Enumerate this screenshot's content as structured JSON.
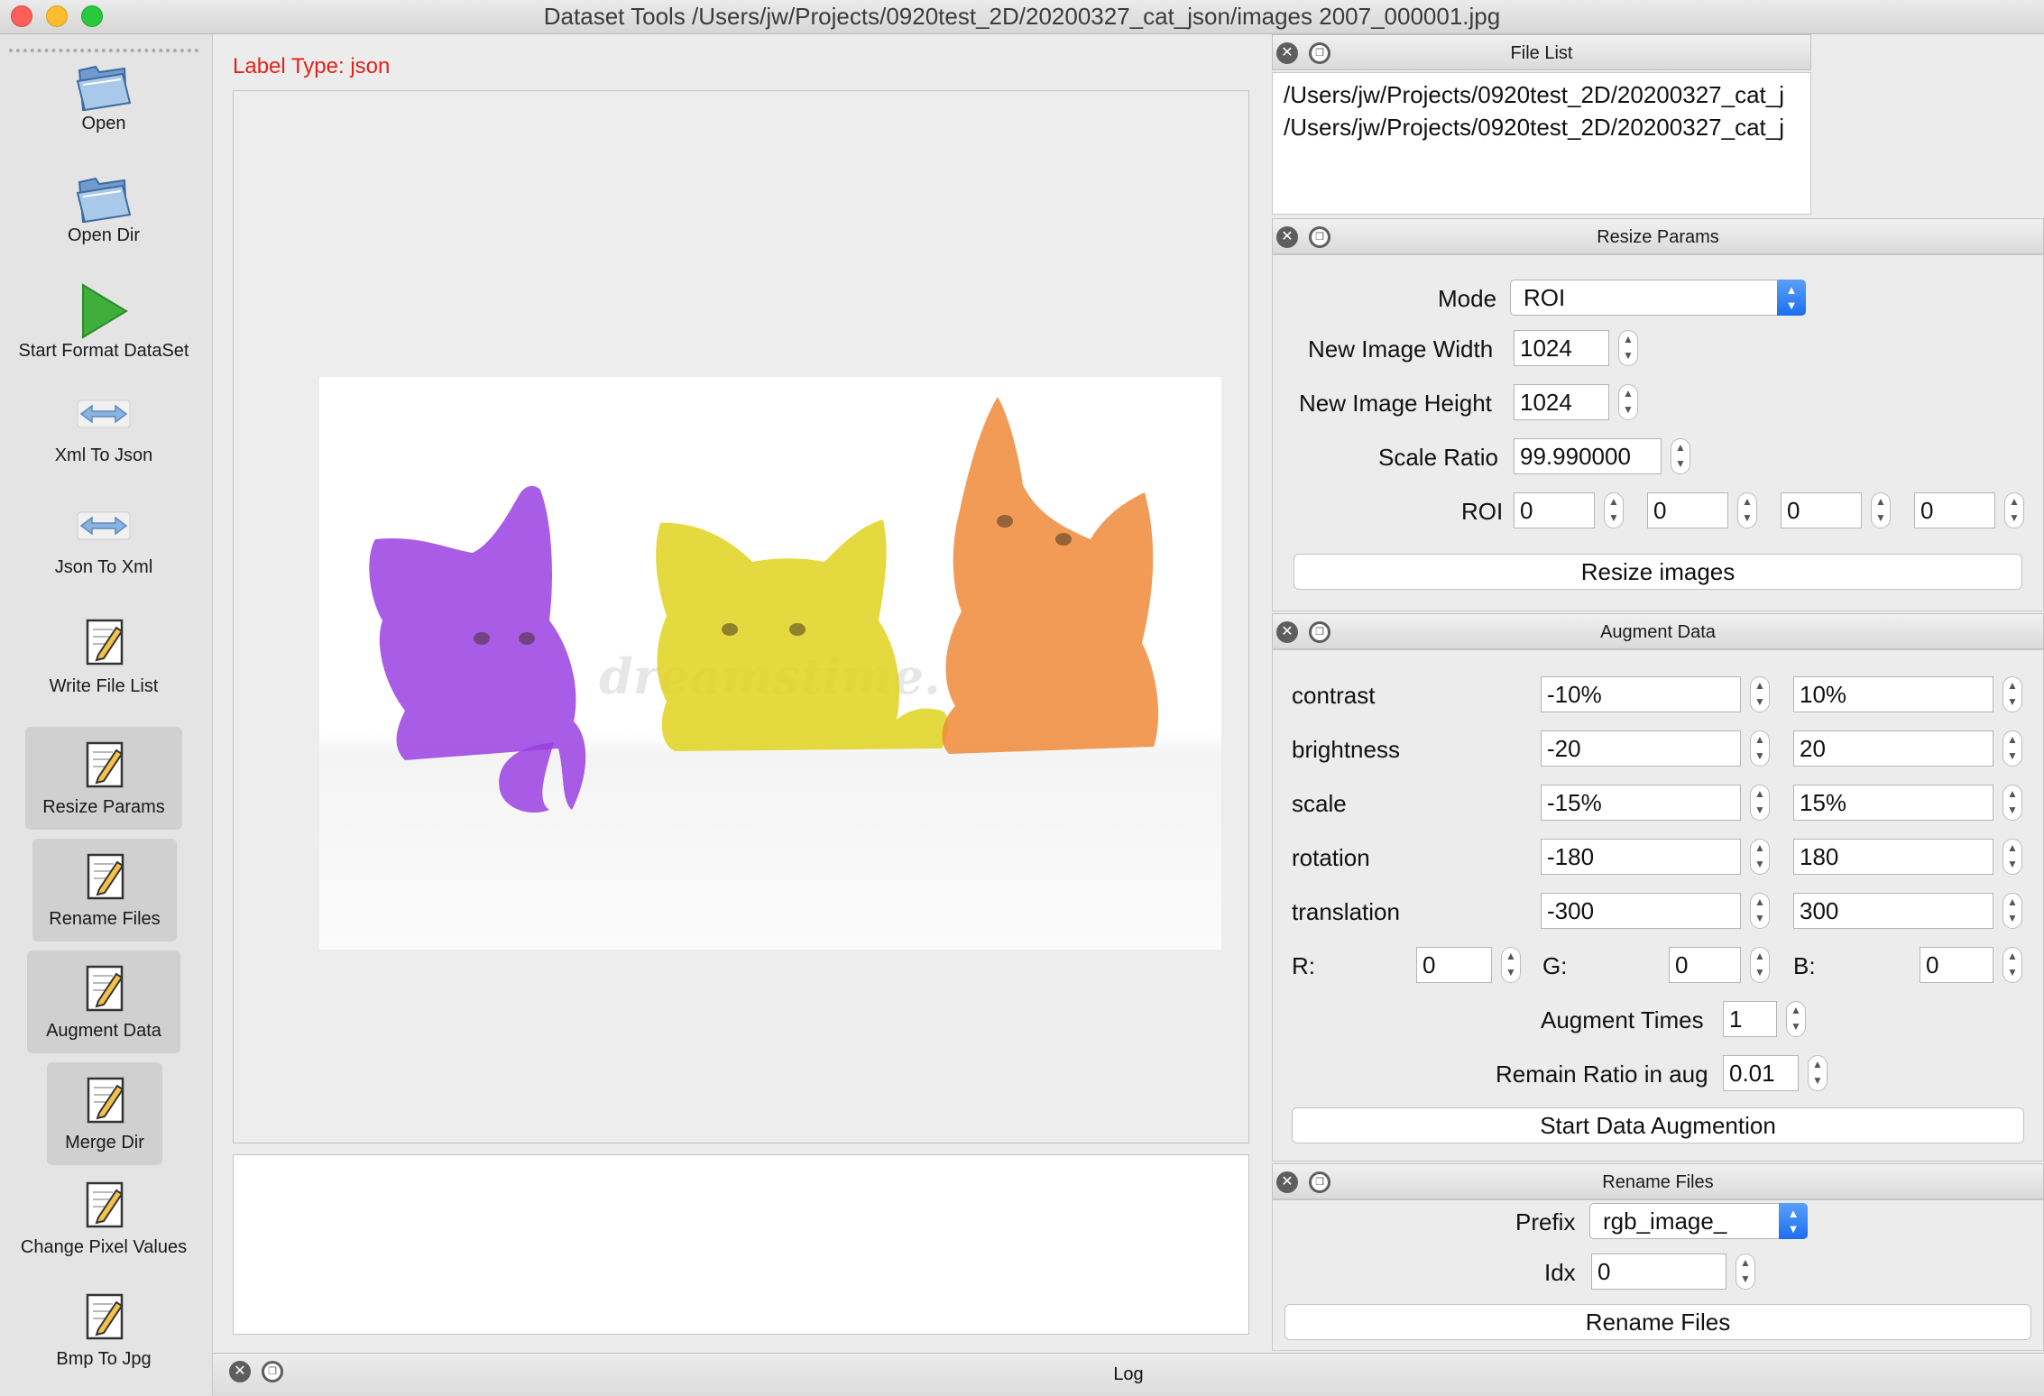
{
  "window": {
    "title": "Dataset Tools /Users/jw/Projects/0920test_2D/20200327_cat_json/images 2007_000001.jpg"
  },
  "toolbar": {
    "open": "Open",
    "open_dir": "Open Dir",
    "start_format": "Start Format DataSet",
    "xml_to_json": "Xml To Json",
    "json_to_xml": "Json To Xml",
    "write_file_list": "Write File List",
    "resize_params": "Resize Params",
    "rename_files": "Rename Files",
    "augment_data": "Augment Data",
    "merge_dir": "Merge Dir",
    "change_pixel_values": "Change Pixel Values",
    "bmp_to_jpg": "Bmp To Jpg"
  },
  "main": {
    "label_type": "Label Type: json",
    "watermark": "dreamstime."
  },
  "colors": {
    "purple": "#9a3fe2",
    "yellow": "#e0d21f",
    "orange": "#ee8a3a",
    "label_red": "#e0231a",
    "accent_blue": "#1c6ef0"
  },
  "file_list": {
    "title": "File List",
    "items": [
      "/Users/jw/Projects/0920test_2D/20200327_cat_j",
      "/Users/jw/Projects/0920test_2D/20200327_cat_j"
    ]
  },
  "resize": {
    "title": "Resize Params",
    "mode_label": "Mode",
    "mode_value": "ROI",
    "width_label": "New Image Width",
    "width_value": "1024",
    "height_label": "New Image Height",
    "height_value": "1024",
    "scale_label": "Scale Ratio",
    "scale_value": "99.990000",
    "roi_label": "ROI",
    "roi_values": [
      "0",
      "0",
      "0",
      "0"
    ],
    "button": "Resize images"
  },
  "augment": {
    "title": "Augment Data",
    "rows": [
      {
        "label": "contrast",
        "min": "-10%",
        "max": "10%"
      },
      {
        "label": "brightness",
        "min": "-20",
        "max": "20"
      },
      {
        "label": "scale",
        "min": "-15%",
        "max": "15%"
      },
      {
        "label": "rotation",
        "min": "-180",
        "max": "180"
      },
      {
        "label": "translation",
        "min": "-300",
        "max": "300"
      }
    ],
    "r_label": "R:",
    "r_value": "0",
    "g_label": "G:",
    "g_value": "0",
    "b_label": "B:",
    "b_value": "0",
    "times_label": "Augment Times",
    "times_value": "1",
    "remain_label": "Remain Ratio in aug",
    "remain_value": "0.01",
    "button": "Start Data Augmention"
  },
  "rename": {
    "title": "Rename Files",
    "prefix_label": "Prefix",
    "prefix_value": "rgb_image_",
    "idx_label": "Idx",
    "idx_value": "0",
    "button": "Rename Files"
  },
  "log": {
    "title": "Log"
  }
}
